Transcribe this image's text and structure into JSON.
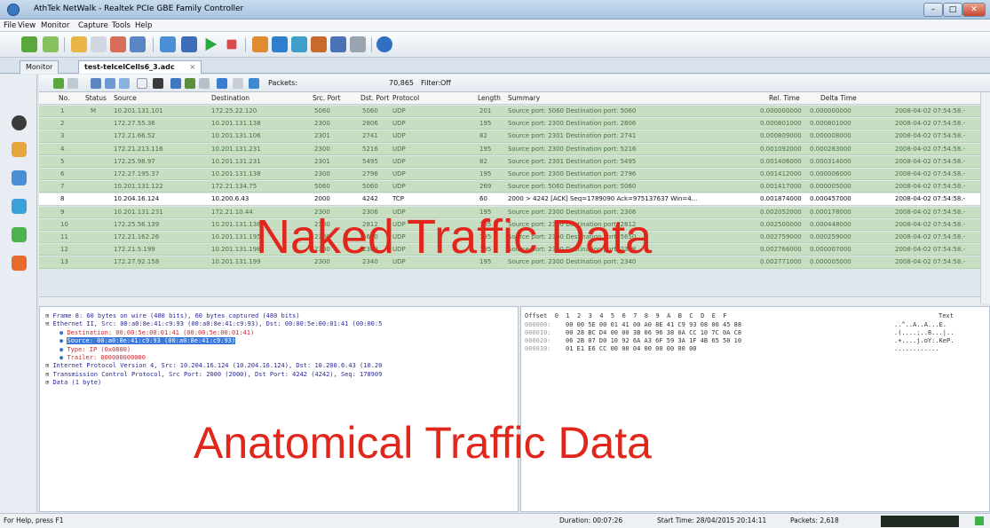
{
  "window": {
    "title": "AthTek NetWalk - Realtek PCIe GBE Family Controller"
  },
  "menu": [
    "File",
    "View",
    "Monitor",
    "Capture",
    "Tools",
    "Help"
  ],
  "tabs": {
    "monitor": "Monitor",
    "capture": "test-telcelCells6_3.adc",
    "close": "×"
  },
  "packet_toolbar": {
    "packets_label": "Packets:",
    "packets_value": "70,865",
    "filter_label": "Filter:",
    "filter_value": "Off"
  },
  "columns": [
    "No.",
    "Status",
    "Source",
    "Destination",
    "Src. Port",
    "Dst. Port",
    "Protocol",
    "Length",
    "Summary",
    "Rel. Time",
    "Delta Time"
  ],
  "rows": [
    {
      "no": "1",
      "status": "M",
      "src": "10.201.131.101",
      "dst": "172.25.22.120",
      "sport": "5060",
      "dport": "5060",
      "proto": "UDP",
      "len": "201",
      "sum": "Source port: 5060 Destination port: 5060",
      "rel": "0.000000000",
      "delta": "0.000000000",
      "ts": "2008-04-02 07:54:58.-"
    },
    {
      "no": "2",
      "status": "",
      "src": "172.27.55.36",
      "dst": "10.201.131.138",
      "sport": "2300",
      "dport": "2806",
      "proto": "UDP",
      "len": "195",
      "sum": "Source port: 2300 Destination port: 2806",
      "rel": "0.000801000",
      "delta": "0.000801000",
      "ts": "2008-04-02 07:54:58.-"
    },
    {
      "no": "3",
      "status": "",
      "src": "172.21.66.52",
      "dst": "10.201.131.106",
      "sport": "2301",
      "dport": "2741",
      "proto": "UDP",
      "len": "82",
      "sum": "Source port: 2301 Destination port: 2741",
      "rel": "0.000809000",
      "delta": "0.000008000",
      "ts": "2008-04-02 07:54:58.-"
    },
    {
      "no": "4",
      "status": "",
      "src": "172.21.213.116",
      "dst": "10.201.131.231",
      "sport": "2300",
      "dport": "5216",
      "proto": "UDP",
      "len": "195",
      "sum": "Source port: 2300 Destination port: 5216",
      "rel": "0.001092000",
      "delta": "0.000283000",
      "ts": "2008-04-02 07:54:58.-"
    },
    {
      "no": "5",
      "status": "",
      "src": "172.25.98.97",
      "dst": "10.201.131.231",
      "sport": "2301",
      "dport": "5495",
      "proto": "UDP",
      "len": "82",
      "sum": "Source port: 2301 Destination port: 5495",
      "rel": "0.001406000",
      "delta": "0.000314000",
      "ts": "2008-04-02 07:54:58.-"
    },
    {
      "no": "6",
      "status": "",
      "src": "172.27.195.37",
      "dst": "10.201.131.138",
      "sport": "2300",
      "dport": "2796",
      "proto": "UDP",
      "len": "195",
      "sum": "Source port: 2300 Destination port: 2796",
      "rel": "0.001412000",
      "delta": "0.000006000",
      "ts": "2008-04-02 07:54:58.-"
    },
    {
      "no": "7",
      "status": "",
      "src": "10.201.131.122",
      "dst": "172.21.134.75",
      "sport": "5060",
      "dport": "5060",
      "proto": "UDP",
      "len": "269",
      "sum": "Source port: 5060 Destination port: 5060",
      "rel": "0.001417000",
      "delta": "0.000005000",
      "ts": "2008-04-02 07:54:58.-"
    },
    {
      "no": "8",
      "status": "",
      "src": "10.204.16.124",
      "dst": "10.200.6.43",
      "sport": "2000",
      "dport": "4242",
      "proto": "TCP",
      "len": "60",
      "sum": "2000 > 4242 [ACK] Seq=1789090 Ack=975137637 Win=4...",
      "rel": "0.001874000",
      "delta": "0.000457000",
      "ts": "2008-04-02 07:54:58.-"
    },
    {
      "no": "9",
      "status": "",
      "src": "10.201.131.231",
      "dst": "172.21.10.44",
      "sport": "2300",
      "dport": "2306",
      "proto": "UDP",
      "len": "195",
      "sum": "Source port: 2300 Destination port: 2306",
      "rel": "0.002052000",
      "delta": "0.000178000",
      "ts": "2008-04-02 07:54:58.-"
    },
    {
      "no": "10",
      "status": "",
      "src": "172.25.56.139",
      "dst": "10.201.131.138",
      "sport": "2300",
      "dport": "2812",
      "proto": "UDP",
      "len": "195",
      "sum": "Source port: 2300 Destination port: 2812",
      "rel": "0.002500000",
      "delta": "0.000448000",
      "ts": "2008-04-02 07:54:58.-"
    },
    {
      "no": "11",
      "status": "",
      "src": "172.21.162.26",
      "dst": "10.201.131.195",
      "sport": "2300",
      "dport": "5650",
      "proto": "UDP",
      "len": "195",
      "sum": "Source port: 2300 Destination port: 5650",
      "rel": "0.002759000",
      "delta": "0.000259000",
      "ts": "2008-04-02 07:54:58.-"
    },
    {
      "no": "12",
      "status": "",
      "src": "172.21.5.199",
      "dst": "10.201.131.198",
      "sport": "2300",
      "dport": "2368",
      "proto": "UDP",
      "len": "195",
      "sum": "Source port: 2300 Destination port: 2368",
      "rel": "0.002766000",
      "delta": "0.000007000",
      "ts": "2008-04-02 07:54:58.-"
    },
    {
      "no": "13",
      "status": "",
      "src": "172.27.92.158",
      "dst": "10.201.131.199",
      "sport": "2300",
      "dport": "2340",
      "proto": "UDP",
      "len": "195",
      "sum": "Source port: 2300 Destination port: 2340",
      "rel": "0.002771000",
      "delta": "0.000005000",
      "ts": "2008-04-02 07:54:58.-"
    }
  ],
  "detail": [
    {
      "text": "Frame 8: 60 bytes on wire (480 bits), 60 bytes captured (480 bits)",
      "level": 0,
      "hl": false,
      "color": "#2a2a9a"
    },
    {
      "text": "Ethernet II, Src: 00:a0:8e:41:c9:93 (00:a0:8e:41:c9:93), Dst: 00:00:5e:00:01:41 (00:00:5",
      "level": 0,
      "hl": false,
      "color": "#2a2a9a"
    },
    {
      "text": "Destination: 00:00:5e:00:01:41 (00:00:5e:00:01:41)",
      "level": 1,
      "hl": false,
      "color": "#c8282f"
    },
    {
      "text": "Source: 00:a0:8e:41:c9:93 (00:a0:8e:41:c9:93)",
      "level": 1,
      "hl": true,
      "color": "#c8282f"
    },
    {
      "text": "Type: IP (0x0800)",
      "level": 1,
      "hl": false,
      "color": "#c8282f"
    },
    {
      "text": "Trailer: 000000000000",
      "level": 1,
      "hl": false,
      "color": "#c8282f"
    },
    {
      "text": "Internet Protocol Version 4, Src: 10.204.16.124 (10.204.16.124), Dst: 10.200.6.43 (10.20",
      "level": 0,
      "hl": false,
      "color": "#2a2a9a"
    },
    {
      "text": "Transmission Control Protocol, Src Port: 2000 (2000), Dst Port: 4242 (4242), Seq: 178909",
      "level": 0,
      "hl": false,
      "color": "#2a2a9a"
    },
    {
      "text": "Data (1 byte)",
      "level": 0,
      "hl": false,
      "color": "#2a2a9a"
    }
  ],
  "hex": {
    "header": "Offset  0  1  2  3  4  5  6  7  8  9  A  B  C  D  E  F",
    "text_header": "Text",
    "lines": [
      {
        "off": "000000:",
        "bytes": "00 00 5E 00 01 41 00 A0 8E 41 C9 93 08 00 45 88",
        "ascii": "..^..A..A...E."
      },
      {
        "off": "000010:",
        "bytes": "00 28 BC D4 00 00 3B 06 96 38 0A CC 10 7C 0A C8",
        "ascii": ".(....;..8...|.."
      },
      {
        "off": "000020:",
        "bytes": "06 2B 07 D0 10 92 6A A3 6F 59 3A 1F 4B 65 50 10",
        "ascii": ".+....j.oY:.KeP."
      },
      {
        "off": "000030:",
        "bytes": "01 E1 E6 CC 00 00 04 00 00 00 00 00",
        "ascii": "............"
      }
    ]
  },
  "overlay": {
    "naked": "Naked Traffic Data",
    "anatomical": "Anatomical Traffic Data"
  },
  "status": {
    "help": "For Help, press F1",
    "duration": "Duration: 00:07:26",
    "start": "Start Time: 28/04/2015 20:14:11",
    "packets": "Packets: 2,618"
  },
  "colors": {
    "row_bg": "#c8dec3",
    "selected_row": "#ffffff",
    "highlight": "#3b79d8",
    "overlay_text": "#e1261c"
  }
}
